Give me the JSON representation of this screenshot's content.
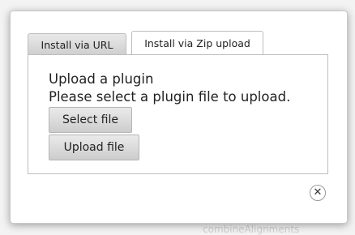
{
  "tabs": [
    {
      "label": "Install via URL"
    },
    {
      "label": "Install via Zip upload"
    }
  ],
  "panel": {
    "title": "Upload a plugin",
    "subtitle": "Please select a plugin file to upload."
  },
  "buttons": {
    "select_file": "Select file",
    "upload_file": "Upload file"
  },
  "close": {
    "glyph": "✕",
    "icon": "close-icon"
  },
  "background": {
    "partial_text": "combineAlignments"
  }
}
